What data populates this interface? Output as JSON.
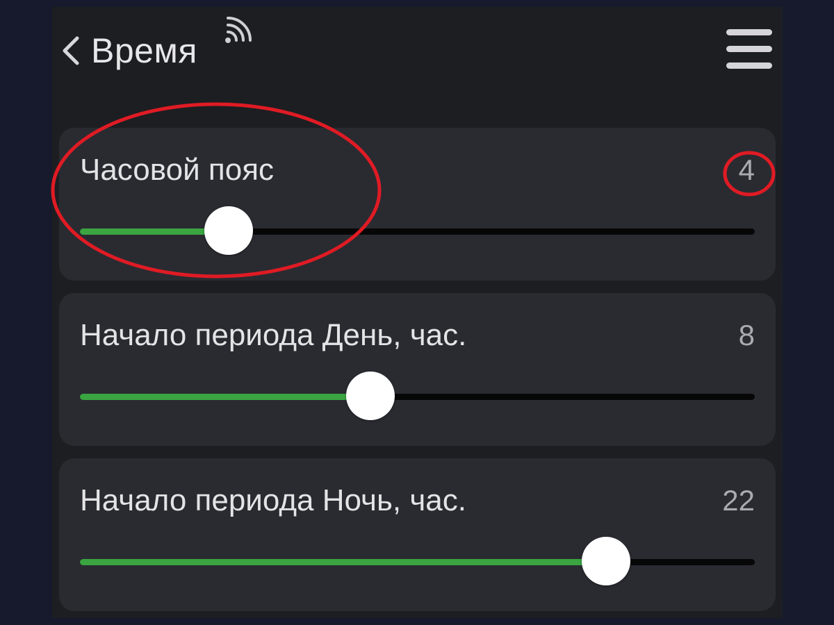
{
  "header": {
    "title": "Время",
    "back_icon": "chevron-left-icon",
    "status_icon": "wifi-signal-icon",
    "menu_icon": "hamburger-menu-icon"
  },
  "settings": [
    {
      "label": "Часовой пояс",
      "value": "4",
      "slider_fill_percent": 22
    },
    {
      "label": "Начало периода День, час.",
      "value": "8",
      "slider_fill_percent": 43
    },
    {
      "label": "Начало периода Ночь, час.",
      "value": "22",
      "slider_fill_percent": 78
    }
  ],
  "colors": {
    "background": "#1d1e22",
    "card": "#2a2b31",
    "slider_fill": "#3aa541",
    "slider_track": "#070708",
    "annotation": "#e01b24"
  }
}
